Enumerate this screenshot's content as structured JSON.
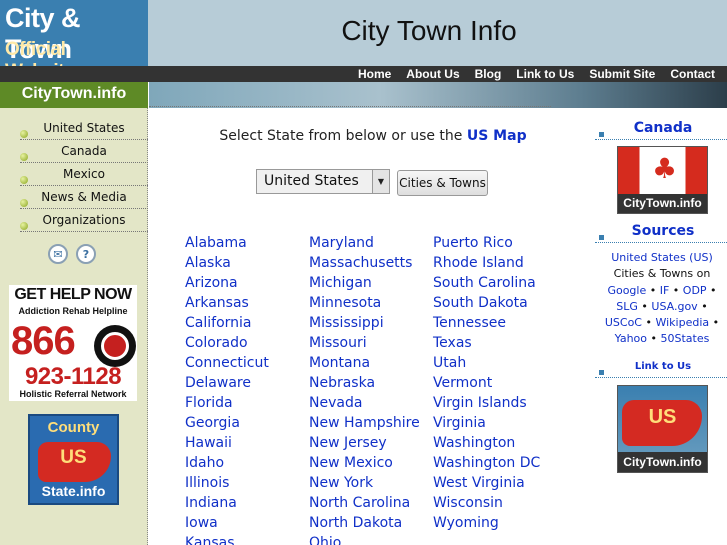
{
  "header": {
    "logo_line1": "City & Town",
    "logo_line2": "Official Websites",
    "title": "City Town Info"
  },
  "nav": [
    "Home",
    "About Us",
    "Blog",
    "Link to Us",
    "Submit Site",
    "Contact"
  ],
  "brand": "CityTown.info",
  "sidebar": {
    "items": [
      "United States",
      "Canada",
      "Mexico",
      "News & Media",
      "Organizations"
    ],
    "icons": [
      "mail-icon",
      "help-icon"
    ]
  },
  "help_ad": {
    "line1": "GET HELP NOW",
    "line2": "Addiction Rehab Helpline",
    "area_code": "866",
    "number": "923-1128",
    "line3": "Holistic Referral Network"
  },
  "county_logo": {
    "line1": "County",
    "line2": "US",
    "line3": "State.info"
  },
  "main": {
    "intro_text": "Select State from below or use the",
    "intro_link": "US Map",
    "select_value": "United States",
    "button_label": "Cities & Towns",
    "states_col1": [
      "Alabama",
      "Alaska",
      "Arizona",
      "Arkansas",
      "California",
      "Colorado",
      "Connecticut",
      "Delaware",
      "Florida",
      "Georgia",
      "Hawaii",
      "Idaho",
      "Illinois",
      "Indiana",
      "Iowa",
      "Kansas"
    ],
    "states_col2": [
      "Maryland",
      "Massachusetts",
      "Michigan",
      "Minnesota",
      "Mississippi",
      "Missouri",
      "Montana",
      "Nebraska",
      "Nevada",
      "New Hampshire",
      "New Jersey",
      "New Mexico",
      "New York",
      "North Carolina",
      "North Dakota",
      "Ohio"
    ],
    "states_col3": [
      "Puerto Rico",
      "Rhode Island",
      "South Carolina",
      "South Dakota",
      "Tennessee",
      "Texas",
      "Utah",
      "Vermont",
      "Virgin Islands",
      "Virginia",
      "Washington",
      "Washington DC",
      "West Virginia",
      "Wisconsin",
      "Wyoming"
    ]
  },
  "right": {
    "canada_heading": "Canada",
    "canada_logo_text": "CityTown.info",
    "sources_heading": "Sources",
    "sources": {
      "l1": "United States (US)",
      "l2": "Cities & Towns on",
      "google": "Google",
      "if": "IF",
      "odp": "ODP",
      "slg": "SLG",
      "usagov": "USA.gov",
      "usco": "USCoC",
      "wiki": "Wikipedia",
      "yahoo": "Yahoo",
      "fifty": "50States"
    },
    "link_heading": "Link to Us",
    "us_logo_text": "US",
    "us_logo_band": "CityTown.info"
  },
  "colors": {
    "link": "#1030c8",
    "brand_green": "#5e8a26",
    "header_blue": "#3a7fb0",
    "sidebar_bg": "#e3e6c7"
  }
}
